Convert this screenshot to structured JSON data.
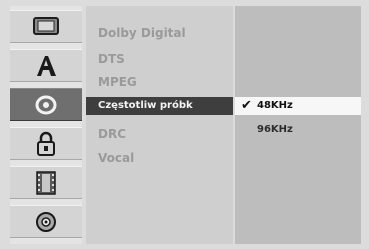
{
  "sidebar": {
    "icons": [
      {
        "name": "tv-icon"
      },
      {
        "name": "language-icon"
      },
      {
        "name": "audio-icon",
        "selected": true
      },
      {
        "name": "lock-icon"
      },
      {
        "name": "film-icon"
      },
      {
        "name": "disc-icon"
      }
    ]
  },
  "settings": {
    "items": [
      {
        "label": "Dolby Digital"
      },
      {
        "label": "DTS"
      },
      {
        "label": "MPEG"
      },
      {
        "label": "Częstotliw próbk",
        "selected": true
      },
      {
        "label": "DRC"
      },
      {
        "label": "Vocal"
      }
    ]
  },
  "options": {
    "check_mark": "✔",
    "items": [
      {
        "label": "48KHz",
        "checked": true
      },
      {
        "label": "96KHz",
        "checked": false
      }
    ]
  },
  "colors": {
    "selected_item_bg": "#3e3e3e",
    "selected_option_bg": "#f7f7f7",
    "panel_bg": "#bdbdbd",
    "list_bg": "#cfcfcf"
  }
}
